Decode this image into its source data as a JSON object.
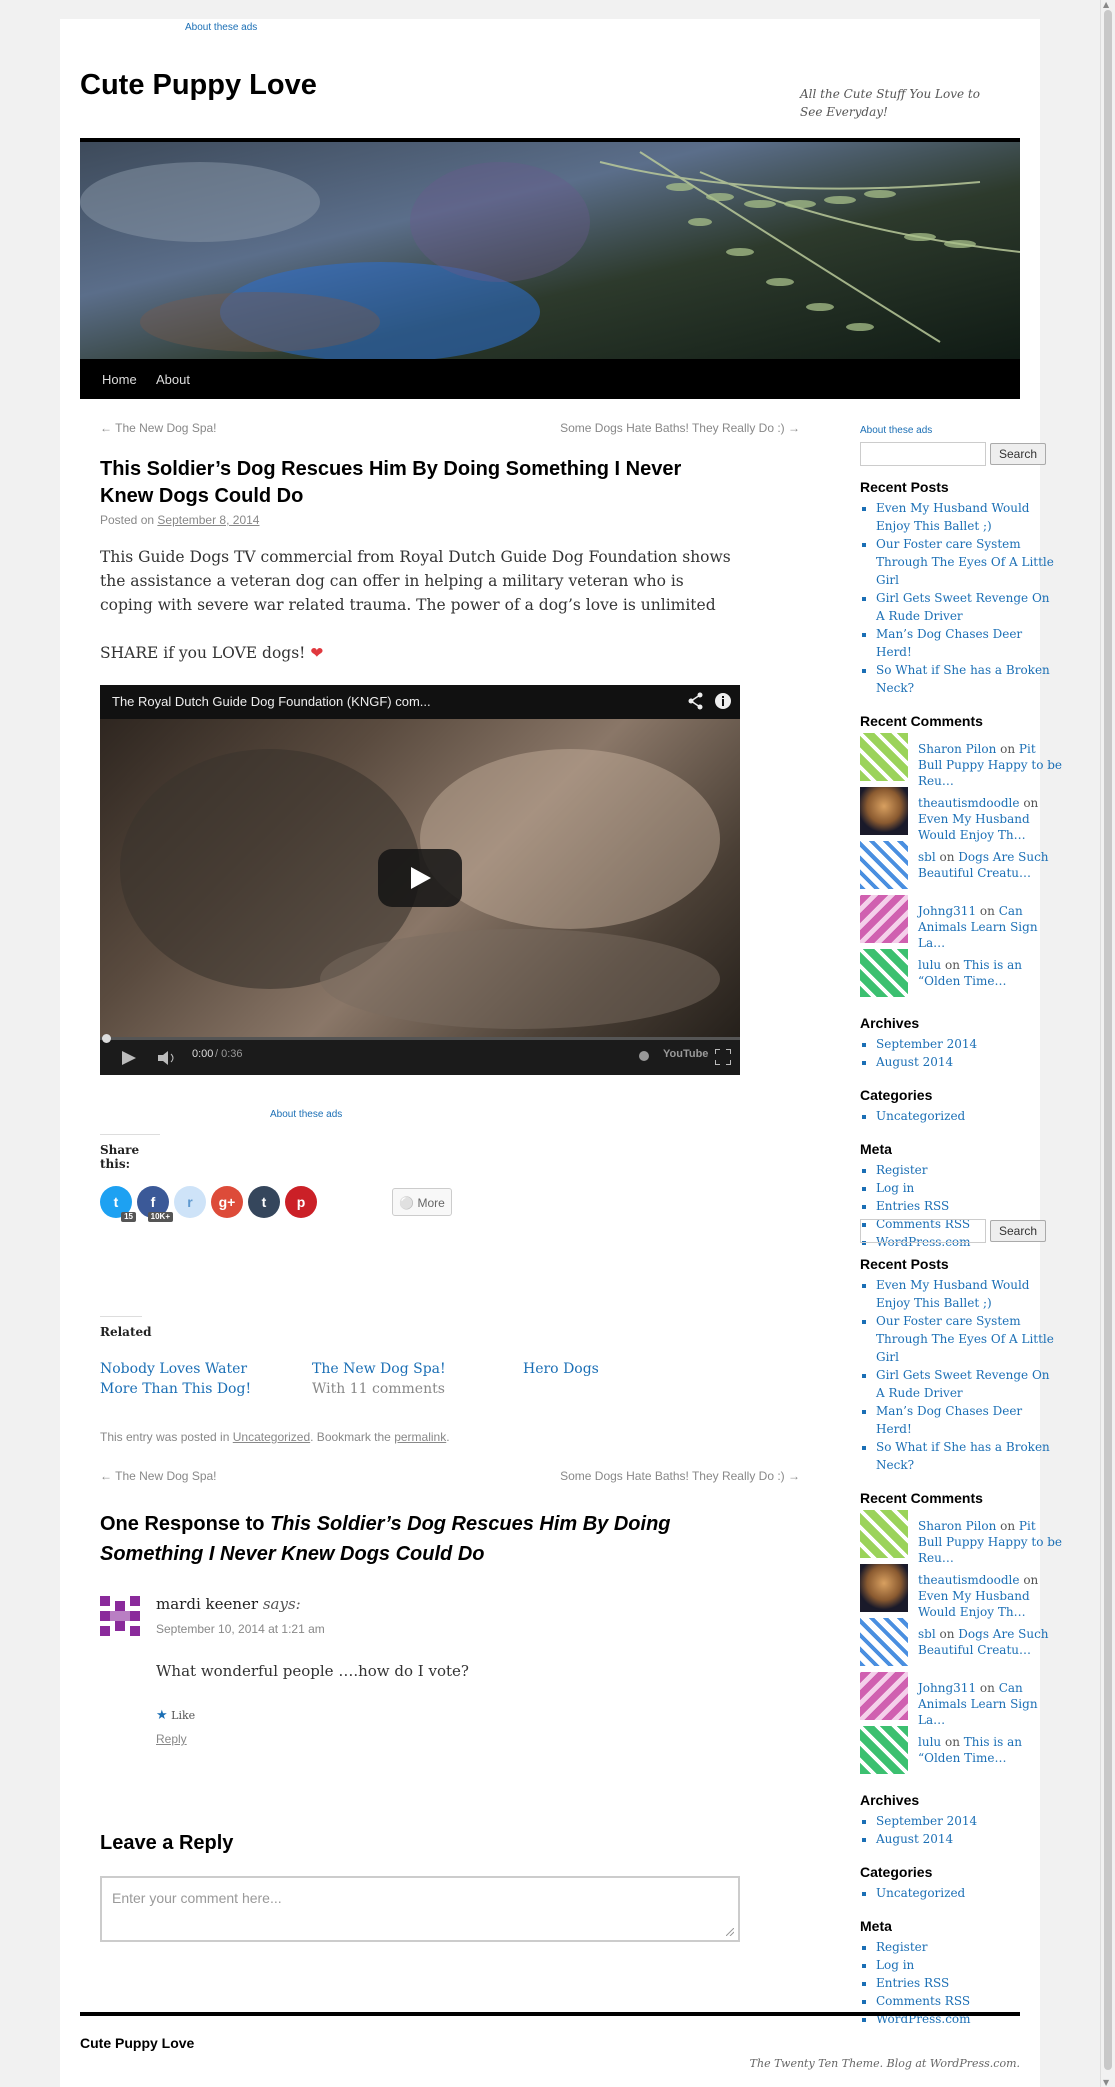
{
  "ads_label": "About these ads",
  "site": {
    "title": "Cute Puppy Love",
    "description": "All the Cute Stuff You Love to See Everyday!"
  },
  "nav": {
    "home": "Home",
    "about": "About"
  },
  "post_nav": {
    "prev": "← The New Dog Spa!",
    "next": "Some Dogs Hate Baths! They Really Do :) →"
  },
  "post": {
    "title": "This Soldier’s Dog Rescues Him By Doing Something I Never Knew Dogs Could Do",
    "posted_on": "Posted on",
    "date": "September 8, 2014",
    "paragraph": "This Guide Dogs TV commercial from Royal Dutch Guide Dog Foundation shows the assistance a veteran dog can offer in helping a military veteran who is coping with severe war related trauma. The power of a dog’s love is unlimited",
    "share_line": "SHARE if you LOVE dogs!",
    "heart_icon": "❤"
  },
  "video": {
    "title": "The Royal Dutch Guide Dog Foundation (KNGF) com...",
    "time_current": "0:00",
    "time_total": "/ 0:36",
    "brand": "YouTube"
  },
  "share": {
    "heading": "Share this:",
    "buttons": [
      {
        "label": "t",
        "count": "15",
        "color": "#1da1f2"
      },
      {
        "label": "f",
        "count": "10K+",
        "color": "#3b5998"
      },
      {
        "label": "r",
        "count": "",
        "color": "#cee3f8"
      },
      {
        "label": "g+",
        "count": "",
        "color": "#dd4b39"
      },
      {
        "label": "t",
        "count": "",
        "color": "#35465c"
      },
      {
        "label": "p",
        "count": "",
        "color": "#cb2027"
      }
    ],
    "more": "More"
  },
  "related": {
    "heading": "Related",
    "items": [
      {
        "title": "Nobody Loves Water More Than This Dog!",
        "sub": ""
      },
      {
        "title": "The New Dog Spa!",
        "sub": "With 11 comments"
      },
      {
        "title": "Hero Dogs",
        "sub": ""
      }
    ]
  },
  "entry_meta": {
    "prefix": "This entry was posted in",
    "category": "Uncategorized",
    "mid": ". Bookmark the",
    "permalink": "permalink",
    "end": "."
  },
  "responses": {
    "prefix": "One Response to",
    "title": "This Soldier’s Dog Rescues Him By Doing Something I Never Knew Dogs Could Do"
  },
  "comment": {
    "author": "mardi keener",
    "says": "says:",
    "date": "September 10, 2014 at 1:21 am",
    "text": "What wonderful people ….how do I vote?",
    "like": "Like",
    "reply": "Reply"
  },
  "reply": {
    "heading": "Leave a Reply",
    "placeholder": "Enter your comment here..."
  },
  "sidebar": {
    "search_button": "Search",
    "recent_posts_heading": "Recent Posts",
    "recent_posts": [
      "Even My Husband Would Enjoy This Ballet ;)",
      "Our Foster care System Through The Eyes Of A Little Girl",
      "Girl Gets Sweet Revenge On A Rude Driver",
      "Man’s Dog Chases Deer Herd!",
      "So What if She has a Broken Neck?"
    ],
    "recent_comments_heading": "Recent Comments",
    "recent_comments": [
      {
        "author": "Sharon Pilon",
        "on": "on",
        "post": "Pit Bull Puppy Happy to be Reu…",
        "color": "#9bd35a"
      },
      {
        "author": "theautismdoodle",
        "on": "on",
        "post": "Even My Husband Would Enjoy Th…",
        "color": "#c48a4a"
      },
      {
        "author": "sbl",
        "on": "on",
        "post": "Dogs Are Such Beautiful Creatu…",
        "color": "#4a8fe0"
      },
      {
        "author": "Johng311",
        "on": "on",
        "post": "Can Animals Learn Sign La…",
        "color": "#d060b0"
      },
      {
        "author": "lulu",
        "on": "on",
        "post": "This is an “Olden Time…",
        "color": "#3cc070"
      }
    ],
    "archives_heading": "Archives",
    "archives": [
      "September 2014",
      "August 2014"
    ],
    "categories_heading": "Categories",
    "categories": [
      "Uncategorized"
    ],
    "meta_heading": "Meta",
    "meta": [
      "Register",
      "Log in",
      "Entries RSS",
      "Comments RSS",
      "WordPress.com"
    ]
  },
  "footer": {
    "title": "Cute Puppy Love",
    "credit": "The Twenty Ten Theme. Blog at WordPress.com."
  }
}
